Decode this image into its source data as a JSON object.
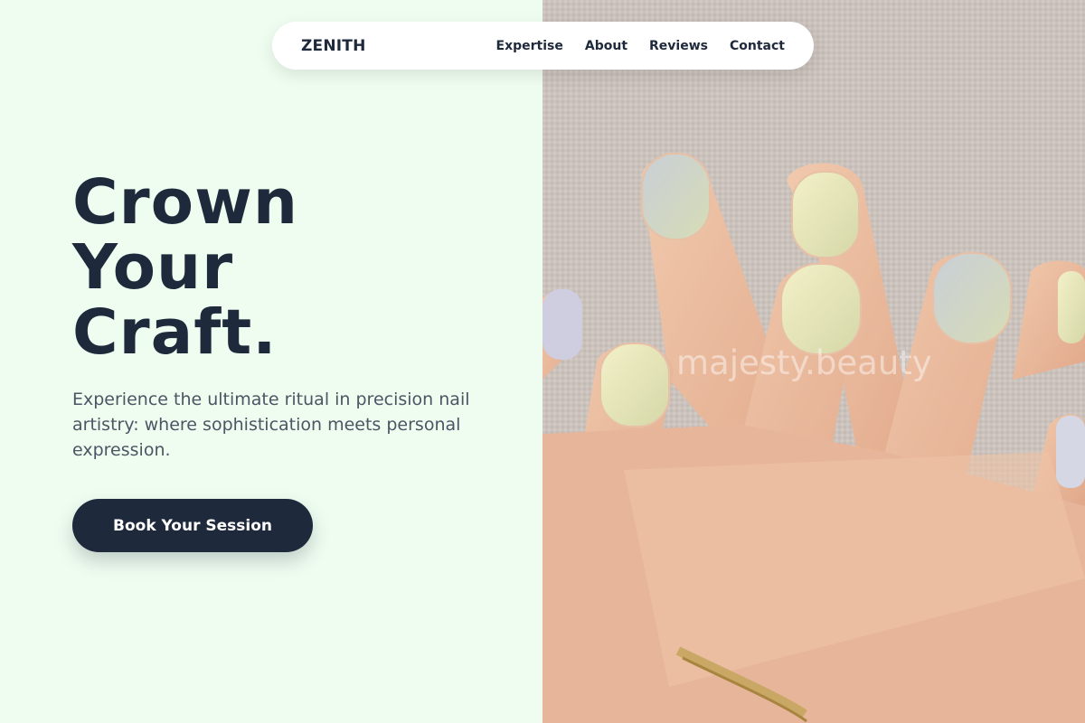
{
  "nav": {
    "brand": "ZENITH",
    "links": [
      "Expertise",
      "About",
      "Reviews",
      "Contact"
    ]
  },
  "hero": {
    "headline": [
      "Crown",
      "Your",
      "Craft."
    ],
    "subtitle": "Experience the ultimate ritual in precision nail artistry: where sophistication meets personal expression.",
    "cta_label": "Book Your Session"
  },
  "photo": {
    "description_icon": "hand-nails-photo",
    "watermark": "majesty.beauty"
  },
  "colors": {
    "background": "#effdf1",
    "primary": "#1e293b",
    "body_text": "#4b5563",
    "white": "#ffffff"
  }
}
